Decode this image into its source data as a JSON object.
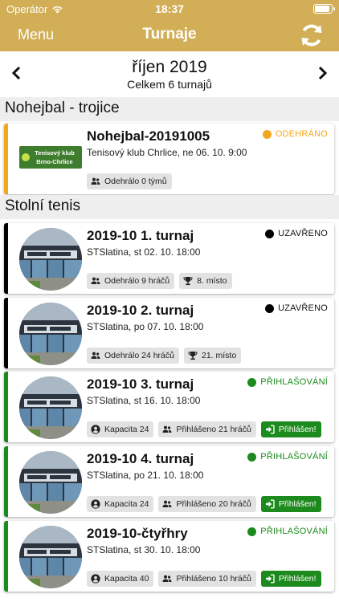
{
  "status_bar": {
    "carrier": "Operátor",
    "time": "18:37"
  },
  "nav": {
    "menu_label": "Menu",
    "title": "Turnaje"
  },
  "month": {
    "label": "říjen 2019",
    "count": "Celkem 6 turnajů"
  },
  "sections": [
    {
      "title": "Nohejbal - trojice",
      "tournaments": [
        {
          "name": "Nohejbal-20191005",
          "info": "Tenisový klub Chrlice, ne 06. 10. 9:00",
          "status": "ODEHRÁNO",
          "status_color": "#f2a81d",
          "accent": "#f2a81d",
          "logo_text": [
            "Tenisový klub",
            "Brno-Chrlice"
          ],
          "chips": [
            {
              "icon": "users-icon",
              "text": "Odehrálo 0 týmů"
            }
          ]
        }
      ]
    },
    {
      "title": "Stolní tenis",
      "tournaments": [
        {
          "name": "2019-10 1. turnaj",
          "info": "STSlatina, st 02. 10. 18:00",
          "status": "UZAVŘENO",
          "status_color": "#000000",
          "accent": "#000000",
          "chips": [
            {
              "icon": "users-icon",
              "text": "Odehrálo 9 hráčů"
            },
            {
              "icon": "trophy-icon",
              "text": "8. místo"
            }
          ]
        },
        {
          "name": "2019-10 2. turnaj",
          "info": "STSlatina, po 07. 10. 18:00",
          "status": "UZAVŘENO",
          "status_color": "#000000",
          "accent": "#000000",
          "chips": [
            {
              "icon": "users-icon",
              "text": "Odehrálo 24 hráčů"
            },
            {
              "icon": "trophy-icon",
              "text": "21. místo"
            }
          ]
        },
        {
          "name": "2019-10 3. turnaj",
          "info": "STSlatina, st 16. 10. 18:00",
          "status": "PŘIHLAŠOVÁNÍ",
          "status_color": "#1c8a1c",
          "accent": "#1c8a1c",
          "chips": [
            {
              "icon": "user-circle-icon",
              "text": "Kapacita 24"
            },
            {
              "icon": "users-icon",
              "text": "Přihlášeno 21 hráčů"
            },
            {
              "icon": "sign-in-icon",
              "text": "Přihlášen!",
              "green": true
            }
          ]
        },
        {
          "name": "2019-10 4. turnaj",
          "info": "STSlatina, po 21. 10. 18:00",
          "status": "PŘIHLAŠOVÁNÍ",
          "status_color": "#1c8a1c",
          "accent": "#1c8a1c",
          "chips": [
            {
              "icon": "user-circle-icon",
              "text": "Kapacita 24"
            },
            {
              "icon": "users-icon",
              "text": "Přihlášeno 20 hráčů"
            },
            {
              "icon": "sign-in-icon",
              "text": "Přihlášen!",
              "green": true
            }
          ]
        },
        {
          "name": "2019-10-čtyřhry",
          "info": "STSlatina, st 30. 10. 18:00",
          "status": "PŘIHLAŠOVÁNÍ",
          "status_color": "#1c8a1c",
          "accent": "#1c8a1c",
          "chips": [
            {
              "icon": "user-circle-icon",
              "text": "Kapacita 40"
            },
            {
              "icon": "users-icon",
              "text": "Přihlášeno 10 hráčů"
            },
            {
              "icon": "sign-in-icon",
              "text": "Přihlášen!",
              "green": true
            }
          ]
        }
      ]
    }
  ],
  "colors": {
    "nav_bg": "#d2ae57",
    "section_bg": "#eeeeee"
  }
}
